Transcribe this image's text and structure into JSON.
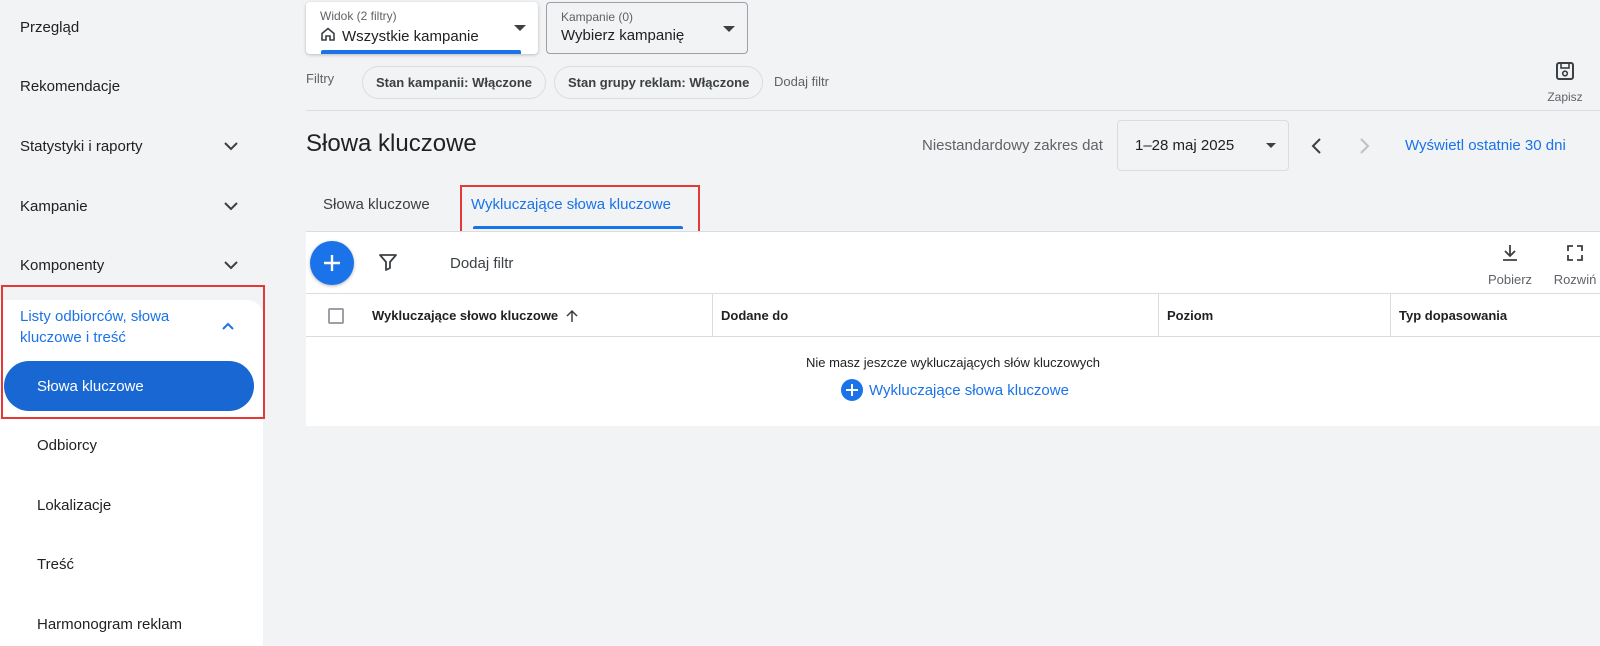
{
  "sidebar": {
    "items": [
      {
        "label": "Przegląd"
      },
      {
        "label": "Rekomendacje"
      },
      {
        "label": "Statystyki i raporty"
      },
      {
        "label": "Kampanie"
      },
      {
        "label": "Komponenty"
      }
    ],
    "group": {
      "label": "Listy odbiorców, słowa kluczowe i treść",
      "active_item": "Słowa kluczowe",
      "sub_items": [
        "Odbiorcy",
        "Lokalizacje",
        "Treść",
        "Harmonogram reklam"
      ]
    }
  },
  "topbar": {
    "view": {
      "label": "Widok (2 filtry)",
      "value": "Wszystkie kampanie"
    },
    "campaign": {
      "label": "Kampanie (0)",
      "value": "Wybierz kampanię"
    },
    "filters_label": "Filtry",
    "chips": [
      "Stan kampanii: Włączone",
      "Stan grupy reklam: Włączone"
    ],
    "add_filter": "Dodaj filtr",
    "save_label": "Zapisz"
  },
  "header": {
    "title": "Słowa kluczowe",
    "date_range_label": "Niestandardowy zakres dat",
    "date_range_value": "1–28 maj 2025",
    "last_30": "Wyświetl ostatnie 30 dni"
  },
  "tabs": [
    {
      "label": "Słowa kluczowe",
      "active": false
    },
    {
      "label": "Wykluczające słowa kluczowe",
      "active": true
    }
  ],
  "table": {
    "add_filter": "Dodaj filtr",
    "download_label": "Pobierz",
    "expand_label": "Rozwiń",
    "columns": [
      "Wykluczające słowo kluczowe",
      "Dodane do",
      "Poziom",
      "Typ dopasowania"
    ],
    "empty_message": "Nie masz jeszcze wykluczających słów kluczowych",
    "empty_action": "Wykluczające słowa kluczowe"
  },
  "colors": {
    "accent": "#1a73e8",
    "active_nav": "#1967d2",
    "highlight": "#e53935"
  }
}
